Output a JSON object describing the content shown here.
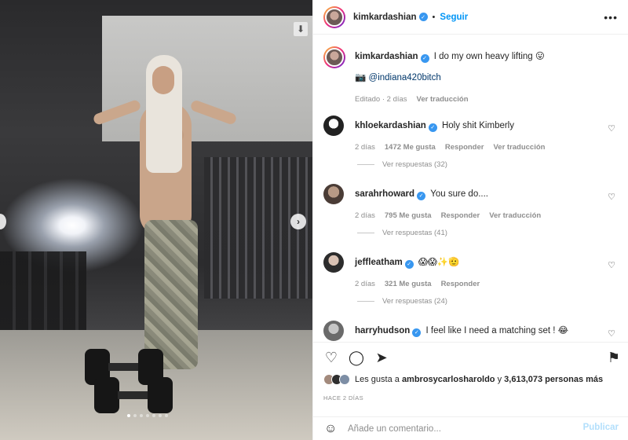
{
  "post": {
    "username": "kimkardashian",
    "follow_label": "Seguir",
    "caption": "I do my own heavy lifting 😛",
    "photo_credit": "📷 @indiana420bitch",
    "edited_meta": "Editado · 2 días",
    "see_translation": "Ver traducción",
    "carousel_count": 7,
    "carousel_active": 0
  },
  "comments": [
    {
      "user": "khloekardashian",
      "text": "Holy shit Kimberly",
      "age": "2 días",
      "likes": "1472 Me gusta",
      "reply": "Responder",
      "translate": "Ver traducción",
      "replies": "Ver respuestas (32)"
    },
    {
      "user": "sarahrhoward",
      "text": "You sure do....",
      "age": "2 días",
      "likes": "795 Me gusta",
      "reply": "Responder",
      "translate": "Ver traducción",
      "replies": "Ver respuestas (41)"
    },
    {
      "user": "jeffleatham",
      "text": "😱😱✨🫡",
      "age": "2 días",
      "likes": "321 Me gusta",
      "reply": "Responder",
      "replies": "Ver respuestas (24)"
    },
    {
      "user": "harryhudson",
      "text": "I feel like I need a matching set ! 😂"
    }
  ],
  "likes": {
    "prefix": "Les gusta a",
    "user": "ambrosycarlosharoldo",
    "middle": "y",
    "others": "3,613,073 personas más"
  },
  "date": "HACE 2 DÍAS",
  "compose": {
    "placeholder": "Añade un comentario...",
    "publish": "Publicar"
  },
  "icons": {
    "download": "download-icon",
    "next": "chevron-right-icon",
    "like": "heart-icon",
    "comment": "comment-icon",
    "share": "send-icon",
    "save": "bookmark-icon",
    "more": "more-icon",
    "emoji": "emoji-icon"
  },
  "colors": {
    "link_blue": "#0095f6",
    "verified_blue": "#3897f0",
    "muted": "#8e8e8e"
  }
}
